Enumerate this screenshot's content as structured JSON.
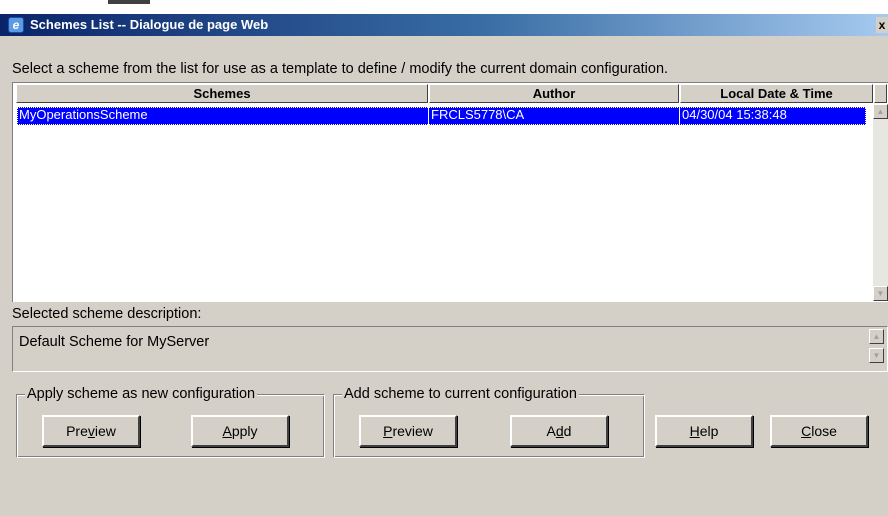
{
  "window": {
    "title": "Schemes List -- Dialogue de page Web",
    "close_glyph": "x"
  },
  "instruction": "Select a scheme from the list for use as a template to define / modify the current domain configuration.",
  "schemes_table": {
    "columns": [
      "Schemes",
      "Author",
      "Local Date & Time"
    ],
    "rows": [
      {
        "scheme": "MyOperationsScheme",
        "author": "FRCLS5778\\CA",
        "datetime": "04/30/04 15:38:48",
        "selected": true
      }
    ]
  },
  "description": {
    "label": "Selected scheme description:",
    "text": "Default Scheme for MyServer"
  },
  "apply_group": {
    "legend": "Apply scheme as new configuration",
    "preview": {
      "pre": "Pre",
      "u": "v",
      "post": "iew"
    },
    "apply": {
      "pre": "",
      "u": "A",
      "post": "pply"
    }
  },
  "add_group": {
    "legend": "Add scheme to current configuration",
    "preview": {
      "pre": "",
      "u": "P",
      "post": "review"
    },
    "add": {
      "pre": "A",
      "u": "d",
      "post": "d"
    }
  },
  "help_button": {
    "pre": "",
    "u": "H",
    "post": "elp"
  },
  "close_button": {
    "pre": "",
    "u": "C",
    "post": "lose"
  },
  "icons": {
    "app": "ie-page-icon",
    "scroll_up": "up-arrow-icon",
    "scroll_down": "down-arrow-icon"
  },
  "colors": {
    "selection": "#0000ff",
    "titlebar_start": "#0a246a",
    "titlebar_end": "#a6caf0",
    "dialog_bg": "#d4d0c8"
  }
}
